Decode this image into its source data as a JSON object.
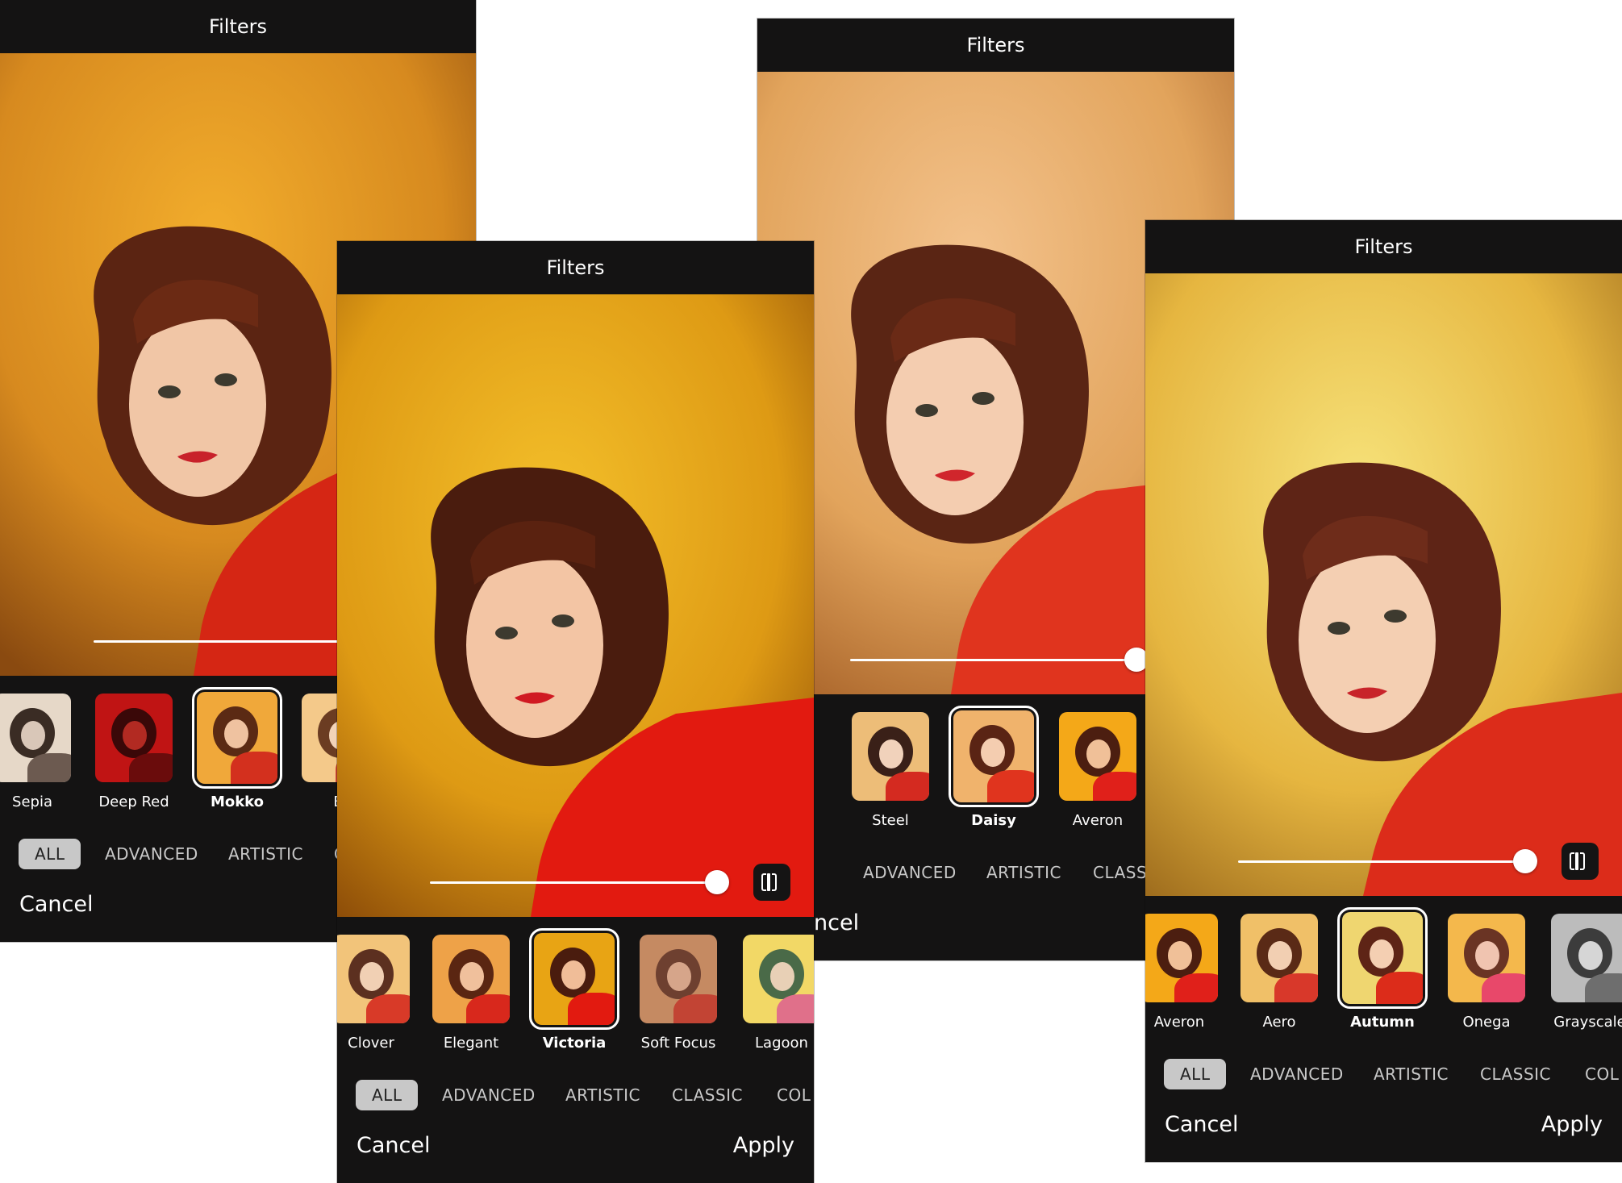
{
  "screens": [
    {
      "title": "Filters",
      "filters": [
        {
          "label": "Sepia",
          "selected": false
        },
        {
          "label": "Deep Red",
          "selected": false
        },
        {
          "label": "Mokko",
          "selected": true
        },
        {
          "label": "Bl",
          "selected": false
        }
      ],
      "categories": [
        {
          "label": "ALL",
          "active": true
        },
        {
          "label": "ADVANCED",
          "active": false
        },
        {
          "label": "ARTISTIC",
          "active": false
        },
        {
          "label": "C",
          "active": false
        }
      ],
      "cancel": "Cancel"
    },
    {
      "title": "Filters",
      "filters": [
        {
          "label": "Clover",
          "selected": false
        },
        {
          "label": "Elegant",
          "selected": false
        },
        {
          "label": "Victoria",
          "selected": true
        },
        {
          "label": "Soft Focus",
          "selected": false
        },
        {
          "label": "Lagoon",
          "selected": false
        }
      ],
      "categories": [
        {
          "label": "ALL",
          "active": true
        },
        {
          "label": "ADVANCED",
          "active": false
        },
        {
          "label": "ARTISTIC",
          "active": false
        },
        {
          "label": "CLASSIC",
          "active": false
        },
        {
          "label": "COL",
          "active": false
        }
      ],
      "cancel": "Cancel",
      "apply": "Apply"
    },
    {
      "title": "Filters",
      "filters": [
        {
          "label": "",
          "selected": false
        },
        {
          "label": "Steel",
          "selected": false
        },
        {
          "label": "Daisy",
          "selected": true
        },
        {
          "label": "Averon",
          "selected": false
        }
      ],
      "categories": [
        {
          "label": "L",
          "active": true
        },
        {
          "label": "ADVANCED",
          "active": false
        },
        {
          "label": "ARTISTIC",
          "active": false
        },
        {
          "label": "CLASSI",
          "active": false
        }
      ],
      "cancel": "ncel"
    },
    {
      "title": "Filters",
      "filters": [
        {
          "label": "Averon",
          "selected": false
        },
        {
          "label": "Aero",
          "selected": false
        },
        {
          "label": "Autumn",
          "selected": true
        },
        {
          "label": "Onega",
          "selected": false
        },
        {
          "label": "Grayscale",
          "selected": false
        }
      ],
      "categories": [
        {
          "label": "ALL",
          "active": true
        },
        {
          "label": "ADVANCED",
          "active": false
        },
        {
          "label": "ARTISTIC",
          "active": false
        },
        {
          "label": "CLASSIC",
          "active": false
        },
        {
          "label": "COL",
          "active": false
        }
      ],
      "cancel": "Cancel",
      "apply": "Apply"
    }
  ]
}
